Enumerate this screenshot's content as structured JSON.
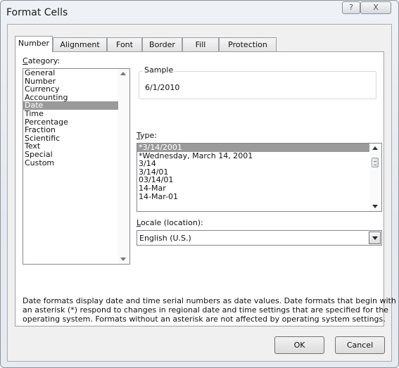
{
  "window": {
    "title": "Format Cells",
    "help_symbol": "?",
    "close_symbol": "X"
  },
  "tabs": [
    {
      "label": "Number",
      "active": true
    },
    {
      "label": "Alignment"
    },
    {
      "label": "Font"
    },
    {
      "label": "Border"
    },
    {
      "label": "Fill"
    },
    {
      "label": "Protection"
    }
  ],
  "category": {
    "label": "Category:",
    "items": [
      "General",
      "Number",
      "Currency",
      "Accounting",
      "Date",
      "Time",
      "Percentage",
      "Fraction",
      "Scientific",
      "Text",
      "Special",
      "Custom"
    ],
    "selected": "Date"
  },
  "sample": {
    "label": "Sample",
    "value": "6/1/2010"
  },
  "type": {
    "label": "Type:",
    "items": [
      "*3/14/2001",
      "*Wednesday, March 14, 2001",
      "3/14",
      "3/14/01",
      "03/14/01",
      "14-Mar",
      "14-Mar-01"
    ],
    "selected": "*3/14/2001"
  },
  "locale": {
    "label": "Locale (location):",
    "value": "English (U.S.)"
  },
  "description": [
    "Date formats display date and time serial numbers as date values.  Date formats that begin with",
    "an asterisk (*) respond to changes in regional date and time settings that are specified for the",
    "operating system. Formats without an asterisk are not affected by operating system settings."
  ],
  "buttons": {
    "ok": "OK",
    "cancel": "Cancel"
  }
}
